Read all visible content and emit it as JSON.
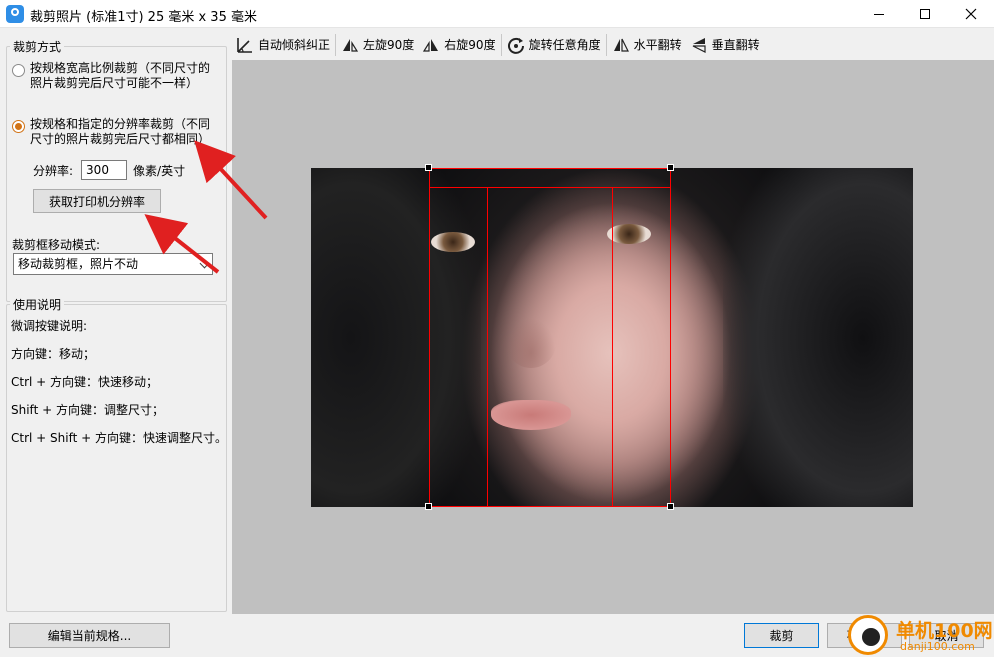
{
  "window": {
    "title": "裁剪照片 (标准1寸) 25 毫米 x 35 毫米",
    "controls": [
      "minimize",
      "maximize",
      "close"
    ]
  },
  "crop_mode": {
    "group_title": "裁剪方式",
    "option_ratio": "按规格宽高比例裁剪（不同尺寸的照片裁剪完后尺寸可能不一样）",
    "option_ratio_checked": false,
    "option_resolution": "按规格和指定的分辨率裁剪（不同尺寸的照片裁剪完后尺寸都相同）",
    "option_resolution_checked": true,
    "resolution_label": "分辨率:",
    "resolution_value": "300",
    "resolution_unit": "像素/英寸",
    "get_printer_resolution_button": "获取打印机分辨率",
    "move_mode_label": "裁剪框移动模式:",
    "move_mode_value": "移动裁剪框，照片不动"
  },
  "help": {
    "group_title": "使用说明",
    "lines": [
      "微调按键说明:",
      "方向键：移动；",
      "Ctrl + 方向键：快速移动；",
      "Shift + 方向键：调整尺寸；",
      "Ctrl + Shift + 方向键：快速调整尺寸。"
    ]
  },
  "toolbar": {
    "auto_deskew": "自动倾斜纠正",
    "rotate_left": "左旋90度",
    "rotate_right": "右旋90度",
    "rotate_any": "旋转任意角度",
    "flip_horizontal": "水平翻转",
    "flip_vertical": "垂直翻转"
  },
  "footer": {
    "edit_spec_button": "编辑当前规格...",
    "crop_button": "裁剪",
    "no_crop_button": "不裁剪",
    "cancel_button": "取消"
  },
  "watermark": {
    "site_name": "单机100网",
    "site_url": "danji100.com"
  },
  "colors": {
    "crop_frame": "#ff0000",
    "annotation_arrow": "#e02020",
    "selected_radio": "#d27316",
    "canvas_bg": "#c0c0c0"
  }
}
